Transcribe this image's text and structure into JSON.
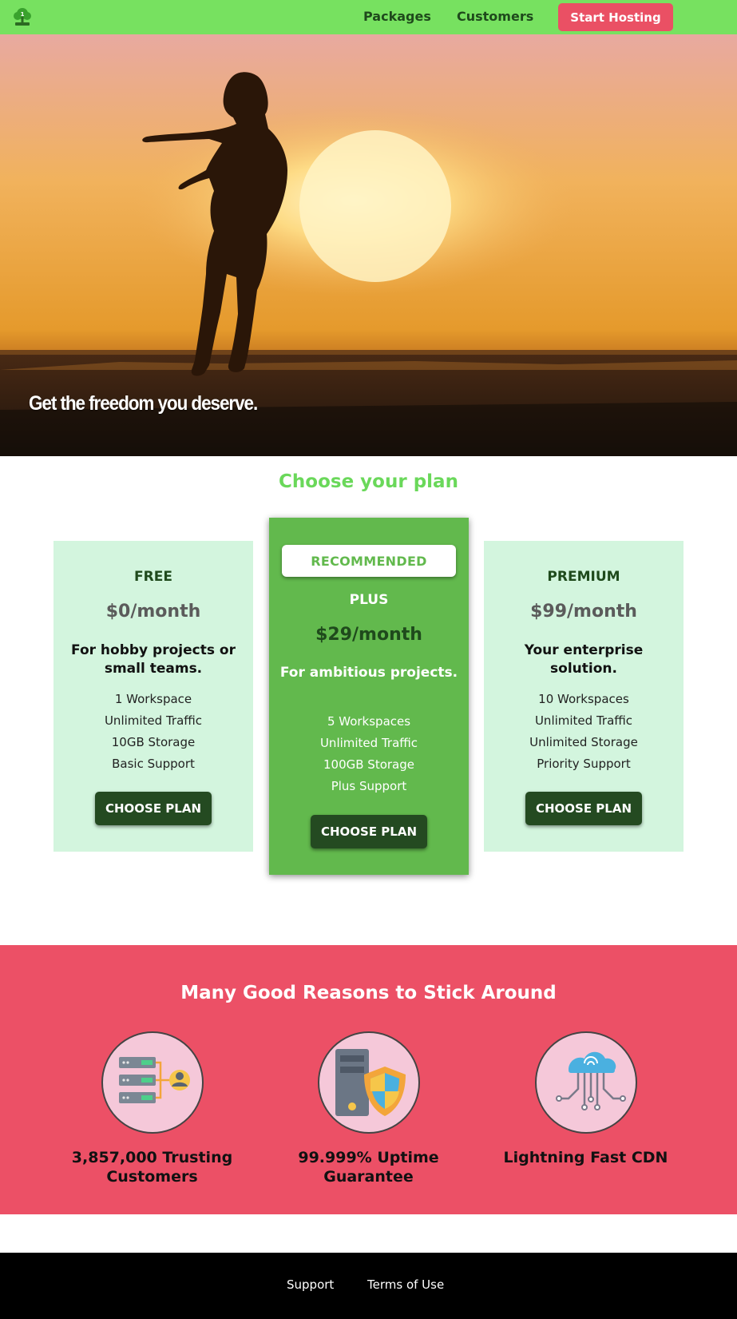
{
  "nav": {
    "logo_icon": "tree-logo-icon",
    "links": [
      "Packages",
      "Customers"
    ],
    "cta_label": "Start Hosting",
    "bg_color": "#77e160",
    "cta_color": "#ea5064"
  },
  "hero": {
    "headline": "Get the freedom you deserve."
  },
  "plans": {
    "title": "Choose your plan",
    "items": [
      {
        "name": "FREE",
        "price": "$0/month",
        "tagline": "For hobby projects or small teams.",
        "features": [
          "1 Workspace",
          "Unlimited Traffic",
          "10GB Storage",
          "Basic Support"
        ],
        "button": "CHOOSE PLAN"
      },
      {
        "badge": "RECOMMENDED",
        "name": "PLUS",
        "price": "$29/month",
        "tagline": "For ambitious projects.",
        "features": [
          "5 Workspaces",
          "Unlimited Traffic",
          "100GB Storage",
          "Plus Support"
        ],
        "button": "CHOOSE PLAN"
      },
      {
        "name": "PREMIUM",
        "price": "$99/month",
        "tagline": "Your enterprise solution.",
        "features": [
          "10 Workspaces",
          "Unlimited Traffic",
          "Unlimited Storage",
          "Priority Support"
        ],
        "button": "CHOOSE PLAN"
      }
    ]
  },
  "reasons": {
    "title": "Many Good Reasons to Stick Around",
    "items": [
      {
        "icon": "server-customer-icon",
        "label": "3,857,000 Trusting Customers"
      },
      {
        "icon": "server-shield-icon",
        "label": "99.999% Uptime Guarantee"
      },
      {
        "icon": "cloud-network-icon",
        "label": "Lightning Fast CDN"
      }
    ],
    "bg_color": "#ec5066"
  },
  "footer": {
    "links": [
      "Support",
      "Terms of Use"
    ]
  }
}
